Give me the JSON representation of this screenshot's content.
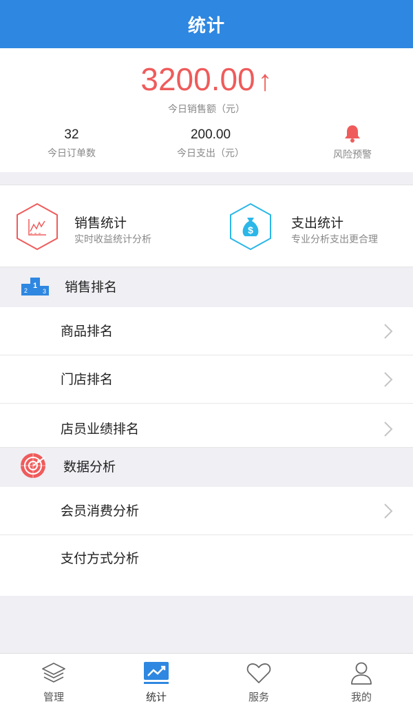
{
  "header": {
    "title": "统计"
  },
  "summary": {
    "sales_amount": "3200.00",
    "sales_arrow": "↑",
    "sales_label": "今日销售额（元）",
    "orders_value": "32",
    "orders_label": "今日订单数",
    "expense_value": "200.00",
    "expense_label": "今日支出（元）",
    "risk_label": "风险预警"
  },
  "quick": {
    "sales_title": "销售统计",
    "sales_sub": "实时收益统计分析",
    "expense_title": "支出统计",
    "expense_sub": "专业分析支出更合理"
  },
  "sections": {
    "ranking_title": "销售排名",
    "ranking_items": [
      "商品排名",
      "门店排名",
      "店员业绩排名"
    ],
    "analysis_title": "数据分析",
    "analysis_items": [
      "会员消费分析",
      "支付方式分析"
    ]
  },
  "tabs": [
    "管理",
    "统计",
    "服务",
    "我的"
  ],
  "colors": {
    "brand_blue": "#2e87e0",
    "accent_red": "#ef5b5b",
    "accent_cyan": "#2bb7e8",
    "background": "#efeff4"
  },
  "icons": {
    "sales_stats": "line-chart-hexagon-icon",
    "expense_stats": "money-bag-hexagon-icon",
    "ranking": "podium-icon",
    "analysis": "radar-icon",
    "risk": "bell-icon",
    "chevron": "chevron-right-icon"
  }
}
